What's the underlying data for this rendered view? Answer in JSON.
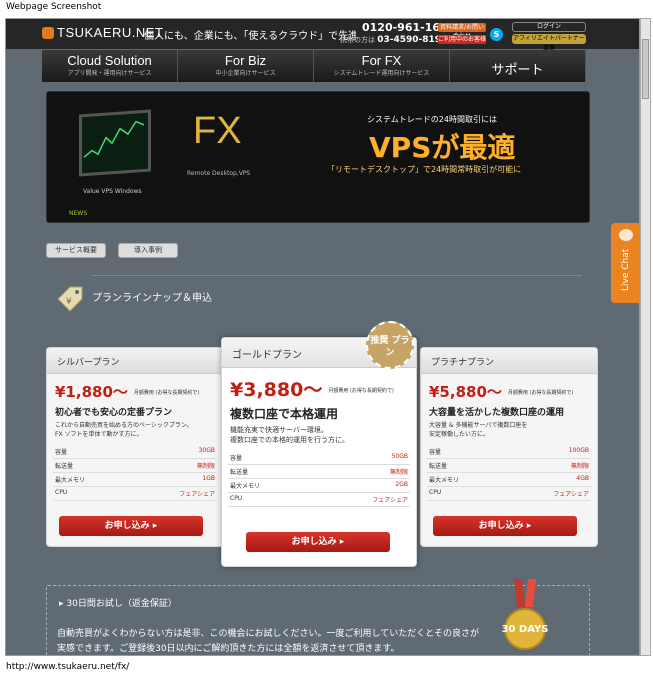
{
  "caption": "Webpage Screenshot",
  "url": "http://www.tsukaeru.net/fx/",
  "header": {
    "logo": "TSUKAERU.NET",
    "ticker": "個人にも、企業にも、「使えるクラウド」で先進のビジ",
    "phone": "0120-961-166",
    "phone_note": "携帯の方は",
    "phone_alt": "03-4590-8198",
    "btn_inquiry": "資料請求/お問い合わせ",
    "btn_apply": "ご利用中のお客様",
    "login": "ログイン",
    "affiliate": "アフィリエイトパートナー募集"
  },
  "nav": [
    {
      "title": "Cloud Solution",
      "sub": "アプリ開発・運用向けサービス"
    },
    {
      "title": "For Biz",
      "sub": "中小企業向けサービス"
    },
    {
      "title": "For FX",
      "sub": "システムトレード運用向けサービス"
    },
    {
      "title": "サポート",
      "sub": ""
    }
  ],
  "banner": {
    "fx": "FX",
    "remote": "Remote Desktop,VPS",
    "value_vps": "Value VPS Windows",
    "line1": "システムトレードの24時間取引には",
    "line2": "VPSが最適",
    "line3": "「リモートデスクトップ」で24時間常時取引が可能に",
    "news": "NEWS"
  },
  "subtabs": [
    "サービス概要",
    "導入事例"
  ],
  "section_title": "プランラインナップ＆申込",
  "recommend": "推奨 プラン",
  "plans": [
    {
      "name": "シルバープラン",
      "price": "¥1,880～",
      "price_note": "月額費用 (お得な長期契約で)",
      "headline": "初心者でも安心の定番プラン",
      "desc1": "これから自動売買を始める方のベーシックプラン。",
      "desc2": "FX ソフトを単体で動かす方に。",
      "specs": [
        [
          "容量",
          "30GB"
        ],
        [
          "転送量",
          "無制限"
        ],
        [
          "最大メモリ",
          "1GB"
        ],
        [
          "CPU",
          "フェアシェア"
        ]
      ],
      "order": "お申し込み ▸"
    },
    {
      "name": "ゴールドプラン",
      "price": "¥3,880～",
      "price_note": "月額費用 (お得な長期契約で)",
      "headline": "複数口座で本格運用",
      "desc1": "機能充実で快適サーバー環境。",
      "desc2": "複数口座での本格的運用を行う方に。",
      "specs": [
        [
          "容量",
          "50GB"
        ],
        [
          "転送量",
          "無制限"
        ],
        [
          "最大メモリ",
          "2GB"
        ],
        [
          "CPU",
          "フェアシェア"
        ]
      ],
      "order": "お申し込み ▸"
    },
    {
      "name": "プラチナプラン",
      "price": "¥5,880～",
      "price_note": "月額費用 (お得な長期契約で)",
      "headline": "大容量を活かした複数口座の運用",
      "desc1": "大容量 & 多機能サーバで複数口座を",
      "desc2": "安定稼働したい方に。",
      "specs": [
        [
          "容量",
          "100GB"
        ],
        [
          "転送量",
          "無制限"
        ],
        [
          "最大メモリ",
          "4GB"
        ],
        [
          "CPU",
          "フェアシェア"
        ]
      ],
      "order": "お申し込み ▸"
    }
  ],
  "live_chat": "Live Chat",
  "trial": {
    "title": "▸ 30日間お試し（返金保証）",
    "line1": "自動売買がよくわからない方は是非、この機会にお試しください。一度ご利用していただくとその良さが",
    "line2": "実感できます。ご登録後30日以内にご解約頂きた方には全額を返済させて頂きます。",
    "medal": "30 DAYS"
  }
}
